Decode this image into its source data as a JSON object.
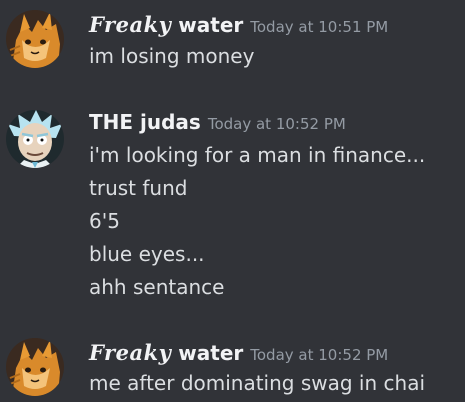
{
  "messages": [
    {
      "username_fancy": "Freaky",
      "username_rest": " water",
      "timestamp": "Today at 10:51 PM",
      "lines": [
        "im losing money"
      ],
      "avatar_icon": "orange-cat-character-avatar"
    },
    {
      "username": "THE judas",
      "timestamp": "Today at 10:52 PM",
      "lines": [
        "i'm looking for a man in finance...",
        "trust fund",
        "6'5",
        "blue eyes...",
        "ahh sentance"
      ],
      "avatar_icon": "rick-sanchez-avatar"
    },
    {
      "username_fancy": "Freaky",
      "username_rest": " water",
      "timestamp": "Today at 10:52 PM",
      "lines": [
        "me after dominating swag in chai"
      ],
      "avatar_icon": "orange-cat-character-avatar"
    }
  ],
  "colors": {
    "background": "#313338",
    "username": "#f2f3f5",
    "timestamp": "#949ba4",
    "text": "#dbdee1"
  }
}
